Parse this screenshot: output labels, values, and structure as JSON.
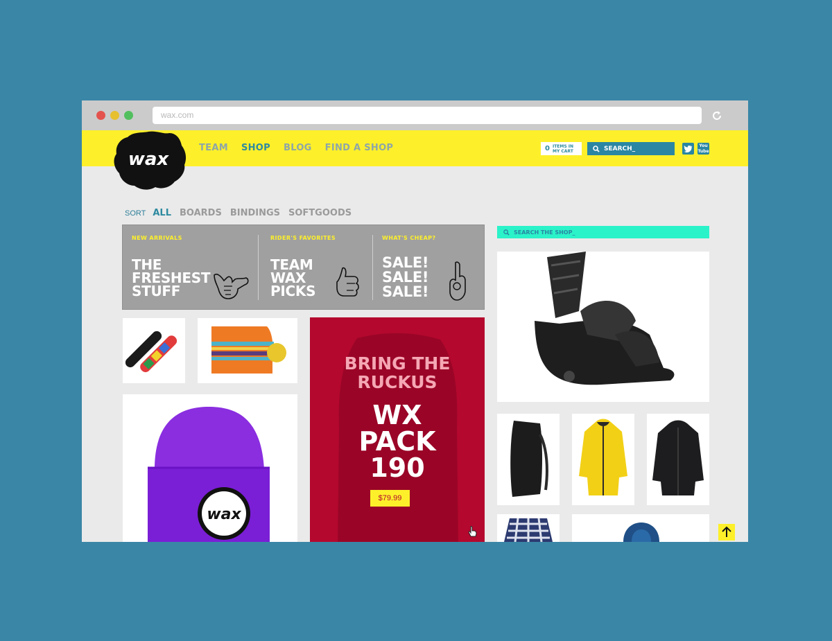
{
  "browser": {
    "url": "wax.com"
  },
  "header": {
    "logo_text": "wax",
    "nav": [
      "TEAM",
      "SHOP",
      "BLOG",
      "FIND A SHOP"
    ],
    "active_nav": "SHOP",
    "cart_count": "0",
    "cart_label": "ITEMS IN MY CART",
    "search_label": "SEARCH_",
    "social": {
      "twitter_icon": "twitter-icon",
      "youtube_label": "You Tube"
    }
  },
  "sort": {
    "label": "SORT",
    "filters": [
      "ALL",
      "BOARDS",
      "BINDINGS",
      "SOFTGOODS"
    ],
    "active": "ALL"
  },
  "promo": {
    "columns": [
      {
        "kicker": "NEW ARRIVALS",
        "lines": [
          "THE",
          "FRESHEST",
          "STUFF"
        ],
        "icon": "shaka-hand-icon"
      },
      {
        "kicker": "RIDER'S FAVORITES",
        "lines": [
          "TEAM",
          "WAX",
          "PICKS"
        ],
        "icon": "thumbs-up-icon"
      },
      {
        "kicker": "WHAT'S CHEAP?",
        "lines": [
          "SALE!",
          "SALE!",
          "SALE!"
        ],
        "icon": "ok-hand-icon"
      }
    ]
  },
  "hero": {
    "tagline_1": "BRING THE",
    "tagline_2": "RUCKUS",
    "product_1": "WX",
    "product_2": "PACK",
    "product_3": "190",
    "price": "$79.99"
  },
  "sidebar": {
    "search_label": "SEARCH THE SHOP_"
  },
  "products": [
    "snowboards",
    "orange-striped-beanie",
    "purple-wax-beanie",
    "snowboard-binding",
    "black-backpack",
    "yellow-jacket",
    "black-jacket",
    "plaid-shirt",
    "blue-hoodie"
  ],
  "colors": {
    "brand_yellow": "#fdf02a",
    "brand_blue": "#2a86a3",
    "hero_red": "#b4082e",
    "accent_mint": "#2bf3c9"
  }
}
